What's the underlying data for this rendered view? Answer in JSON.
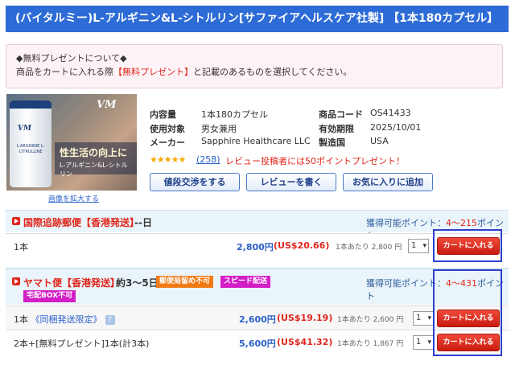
{
  "title": "(バイタルミー)L-アルギニン&L-シトルリン[サファイアヘルスケア社製] 【1本180カプセル】",
  "notice": {
    "line1": "◆無料プレゼントについて◆",
    "line2_prefix": "商品をカートに入れる際",
    "line2_highlight": "【無料プレゼント】",
    "line2_suffix": "と記載のあるものを選択してください。"
  },
  "product_image": {
    "bottle_logo": "VM",
    "bottle_text": "L-ARGININE L-CITRULLINE",
    "brand_logo": "VM",
    "banner_big": "性生活の向上に",
    "banner_small": "L-アルギニン&L-シトルリン",
    "enlarge_link": "画像を拡大する"
  },
  "info": {
    "content_label": "内容量",
    "content_value": "1本180カプセル",
    "target_label": "使用対象",
    "target_value": "男女兼用",
    "maker_label": "メーカー",
    "maker_value": "Sapphire Healthcare LLC",
    "code_label": "商品コード",
    "code_value": "OS41433",
    "expiry_label": "有効期限",
    "expiry_value": "2025/10/01",
    "country_label": "製造国",
    "country_value": "USA"
  },
  "rating": {
    "stars": "★★★★★",
    "review_count": "(258)",
    "promo": "レビュー投稿者には50ポイントプレゼント！"
  },
  "buttons": {
    "negotiate": "値段交渉をする",
    "write_review": "レビューを書く",
    "favorite": "お気に入りに追加"
  },
  "shipping1": {
    "name": "国際追跡郵便【香港発送】",
    "days": "--日",
    "points_prefix": "獲得可能ポイント：",
    "points_range": "4〜215",
    "points_suffix": "ポイント",
    "rows": [
      {
        "label": "1本",
        "price": "2,800円",
        "usd": "(US$20.66)",
        "unit": "1本あたり 2,800 円",
        "qty": "1",
        "cart": "カートに入れる"
      }
    ]
  },
  "shipping2": {
    "name": "ヤマト便【香港発送】",
    "days": "約3〜5日",
    "tag1": "郵便局留め不可",
    "tag2": "スピード配送",
    "tag3": "宅配BOX不可",
    "points_prefix": "獲得可能ポイント：",
    "points_range": "4〜431",
    "points_suffix": "ポイント",
    "rows": [
      {
        "label": "1本",
        "label_link": "《同梱発送限定》",
        "help": "?",
        "price": "2,600円",
        "usd": "(US$19.19)",
        "unit": "1本あたり 2,600 円",
        "qty": "1",
        "cart": "カートに入れる"
      },
      {
        "label": "2本+[無料プレゼント]1本(計3本)",
        "price": "5,600円",
        "usd": "(US$41.32)",
        "unit": "1本あたり 1,867 円",
        "qty": "1",
        "cart": "カートに入れる"
      }
    ]
  },
  "colors": {
    "title_bg": "#2d6bd6",
    "accent_red": "#e0261c",
    "link_blue": "#2a60c8",
    "tag_orange": "#f07b16",
    "tag_magenta": "#d31ec6",
    "highlight_frame": "#2e3fcf"
  }
}
